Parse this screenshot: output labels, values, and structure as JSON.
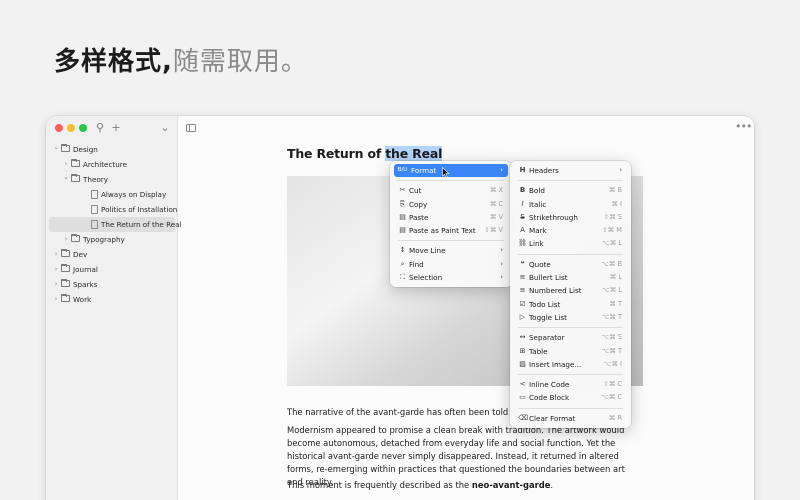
{
  "headline": {
    "bold": "多样格式,",
    "dim": "随需取用。"
  },
  "sidebar": {
    "toolbar": {
      "search_icon": "⚲",
      "add_icon": "+",
      "dropdown_icon": "⌄"
    },
    "tree": [
      {
        "label": "Design",
        "level": 0,
        "type": "folder",
        "expanded": true
      },
      {
        "label": "Architecture",
        "level": 1,
        "type": "folder",
        "expanded": false
      },
      {
        "label": "Theory",
        "level": 1,
        "type": "folder",
        "expanded": true
      },
      {
        "label": "Always on Display",
        "level": 2,
        "type": "doc"
      },
      {
        "label": "Politics of Installation",
        "level": 2,
        "type": "doc"
      },
      {
        "label": "The Return of the Real",
        "level": 2,
        "type": "doc",
        "selected": true
      },
      {
        "label": "Typography",
        "level": 1,
        "type": "folder",
        "expanded": false
      },
      {
        "label": "Dev",
        "level": 0,
        "type": "folder",
        "expanded": false
      },
      {
        "label": "Journal",
        "level": 0,
        "type": "folder",
        "expanded": false
      },
      {
        "label": "Sparks",
        "level": 0,
        "type": "folder",
        "expanded": false
      },
      {
        "label": "Work",
        "level": 0,
        "type": "folder",
        "expanded": false
      }
    ]
  },
  "editor": {
    "title_plain": "The Return of ",
    "title_selected": "the Real",
    "para1": "The narrative of the avant-garde has often been told as a",
    "para2": "Modernism appeared to promise a clean break with tradition. The artwork would become autonomous, detached from everyday life and social function. Yet the historical avant-garde never simply disappeared. Instead, it returned in altered forms, re-emerging within practices that questioned the boundaries between art and reality.",
    "para3_plain": "This moment is frequently described as the ",
    "para3_bold": "neo-avant-garde",
    "para3_end": "."
  },
  "context_menu": {
    "format": {
      "label": "Format",
      "icon": "B/U"
    },
    "items1": [
      {
        "label": "Cut",
        "icon": "✂",
        "shortcut": "⌘ X"
      },
      {
        "label": "Copy",
        "icon": "⎘",
        "shortcut": "⌘ C"
      },
      {
        "label": "Paste",
        "icon": "▤",
        "shortcut": "⌘ V"
      },
      {
        "label": "Paste as Paint Text",
        "icon": "▤",
        "shortcut": "⇧⌘ V"
      }
    ],
    "items2": [
      {
        "label": "Move Line",
        "icon": "↕"
      },
      {
        "label": "Find",
        "icon": "⌕"
      },
      {
        "label": "Selection",
        "icon": "⛶"
      }
    ]
  },
  "format_menu": {
    "headers": {
      "label": "Headers",
      "icon": "H"
    },
    "group1": [
      {
        "label": "Bold",
        "icon": "B",
        "shortcut": "⌘ B"
      },
      {
        "label": "Italic",
        "icon": "I",
        "shortcut": "⌘ I"
      },
      {
        "label": "Strikethrough",
        "icon": "S",
        "shortcut": "⇧⌘ S"
      },
      {
        "label": "Mark",
        "icon": "A",
        "shortcut": "⇧⌘ M"
      },
      {
        "label": "Link",
        "icon": "⛓",
        "shortcut": "⌥⌘ L"
      }
    ],
    "group2": [
      {
        "label": "Quote",
        "icon": "❝",
        "shortcut": "⌥⌘ B"
      },
      {
        "label": "Bullert List",
        "icon": "≡",
        "shortcut": "⌘ L"
      },
      {
        "label": "Numbered List",
        "icon": "≡",
        "shortcut": "⌥⌘ L"
      },
      {
        "label": "Todo List",
        "icon": "☑",
        "shortcut": "⌘ T"
      },
      {
        "label": "Toggle List",
        "icon": "▷",
        "shortcut": "⌥⌘ T"
      }
    ],
    "group3": [
      {
        "label": "Separator",
        "icon": "↔",
        "shortcut": "⌥⌘ S"
      },
      {
        "label": "Table",
        "icon": "⊞",
        "shortcut": "⌥⌘ T"
      },
      {
        "label": "Insert Image...",
        "icon": "▨",
        "shortcut": "⌥⌘ I"
      }
    ],
    "group4": [
      {
        "label": "Inline Code",
        "icon": "<",
        "shortcut": "⇧⌘ C"
      },
      {
        "label": "Code Block",
        "icon": "▭",
        "shortcut": "⌥⌘ C"
      }
    ],
    "group5": [
      {
        "label": "Clear Format",
        "icon": "⌫",
        "shortcut": "⌘ R"
      }
    ]
  },
  "colors": {
    "accent": "#3b86f7",
    "selection": "#b3d4fb",
    "close": "#fe5f57",
    "minimize": "#febc2e",
    "zoom": "#28c840"
  }
}
